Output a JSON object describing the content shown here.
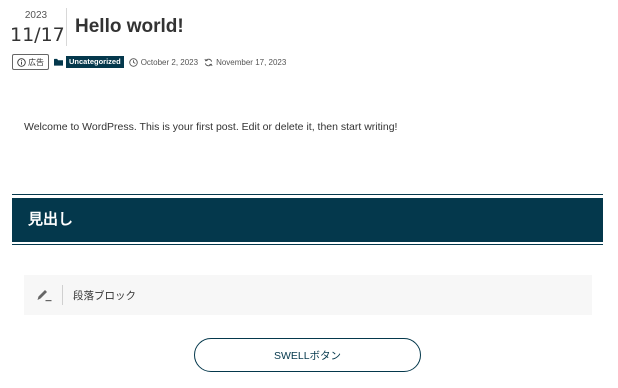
{
  "post": {
    "date_year": "2023",
    "date_month_day": "11/17",
    "title": "Hello world!",
    "ad_label": "広告",
    "category": "Uncategorized",
    "published_date": "October 2, 2023",
    "updated_date": "November 17, 2023",
    "body_text": "Welcome to WordPress. This is your first post. Edit or delete it, then start writing!"
  },
  "heading_block": {
    "text": "見出し",
    "color": "#04384c"
  },
  "paragraph_block": {
    "icon": "pencil-icon",
    "label": "段落ブロック"
  },
  "button": {
    "label": "SWELLボタン"
  },
  "icons": {
    "ad": "info-circle-icon",
    "category": "folder-icon",
    "published": "clock-icon",
    "updated": "refresh-icon"
  }
}
